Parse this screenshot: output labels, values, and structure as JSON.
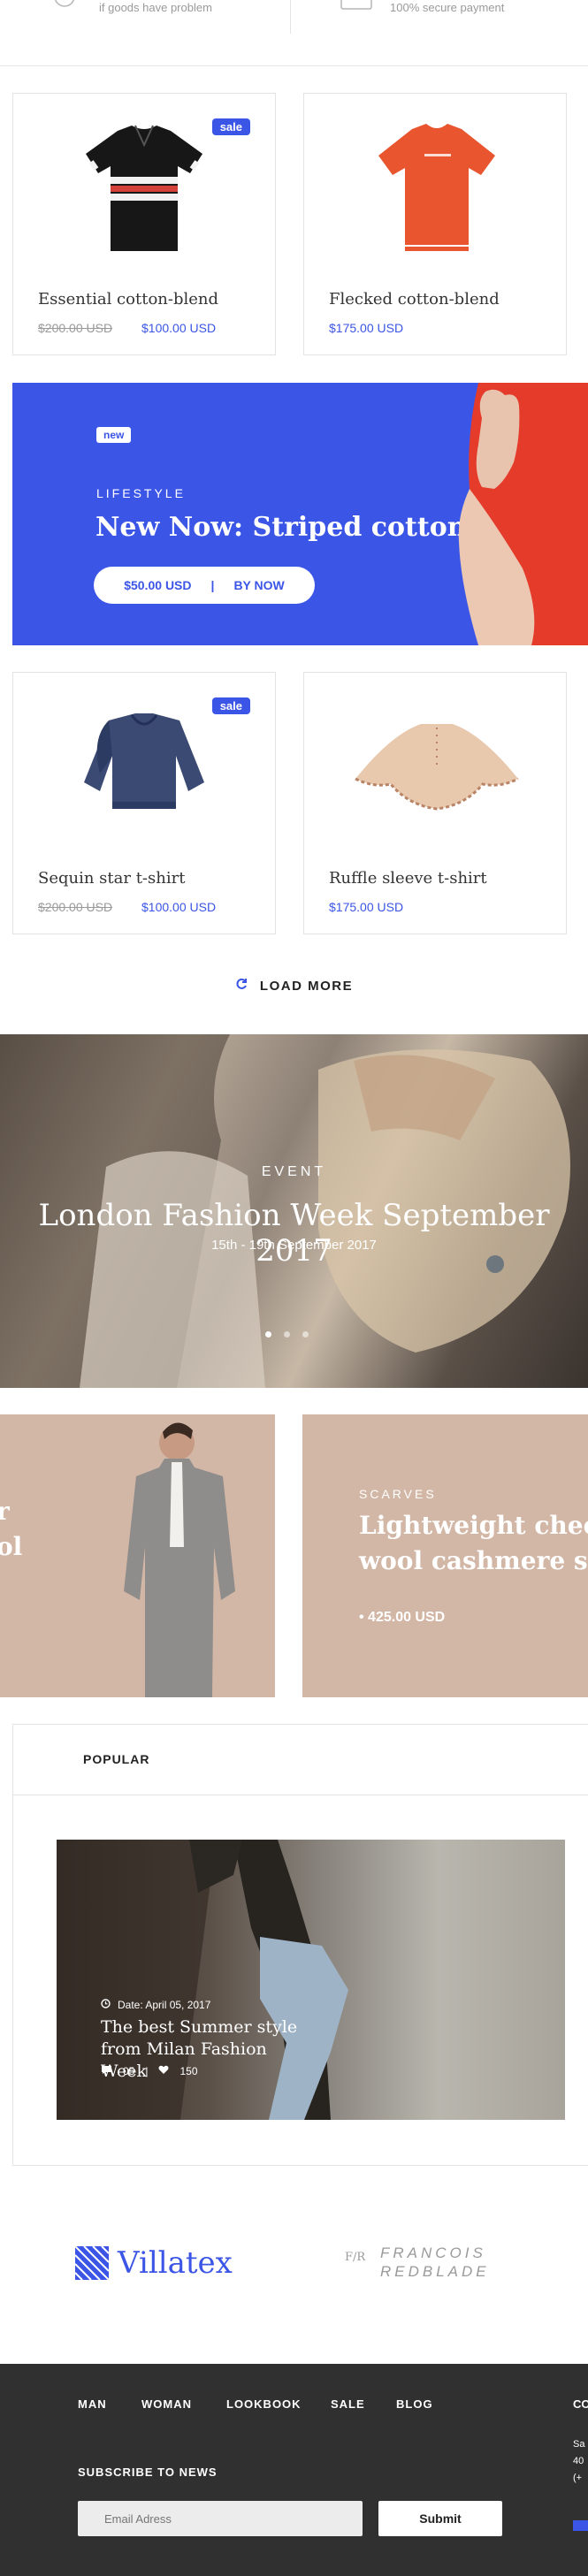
{
  "features": {
    "left_text": "if goods have problem",
    "right_text": "100% secure payment"
  },
  "products_row1": [
    {
      "name": "Essential cotton-blend",
      "old_price": "$200.00 USD",
      "price": "$100.00 USD",
      "badge": "sale"
    },
    {
      "name": "Flecked cotton-blend",
      "old_price": "",
      "price": "$175.00 USD",
      "badge": ""
    }
  ],
  "promo": {
    "badge": "new",
    "kicker": "LIFESTYLE",
    "title": "New Now: Striped cotton",
    "price": "$50.00 USD",
    "separator": "|",
    "cta": "BY NOW"
  },
  "products_row2": [
    {
      "name": "Sequin star t-shirt",
      "old_price": "$200.00 USD",
      "price": "$100.00 USD",
      "badge": "sale"
    },
    {
      "name": "Ruffle sleeve t-shirt",
      "old_price": "",
      "price": "$175.00 USD",
      "badge": ""
    }
  ],
  "load_more": "LOAD MORE",
  "event": {
    "kicker": "EVENT",
    "title": "London Fashion Week September 2017",
    "dates": "15th - 19th September 2017"
  },
  "tiles": {
    "left_partial_line1": "r",
    "left_partial_line2": "ol",
    "right_kicker": "SCARVES",
    "right_title_line1": "Lightweight check",
    "right_title_line2": "wool cashmere sca",
    "right_price": "• 425.00 USD"
  },
  "popular": {
    "heading": "POPULAR",
    "post": {
      "date": "Date: April 05, 2017",
      "title": "The best Summer style from Milan Fashion Week",
      "comments": "05",
      "separator": "|",
      "likes": "150"
    }
  },
  "brands": {
    "brand1": "Villatex",
    "brand2_mark": "F/R",
    "brand2_line1": "FRANCOIS",
    "brand2_line2": "REDBLADE"
  },
  "footer": {
    "nav": [
      "MAN",
      "WOMAN",
      "LOOKBOOK",
      "SALE",
      "BLOG"
    ],
    "subscribe_label": "SUBSCRIBE TO NEWS",
    "email_placeholder": "Email Adress",
    "submit_label": "Submit",
    "right_col_title": "CO",
    "right_col_line1": "Sa",
    "right_col_line2": "40",
    "right_col_line3": "(+"
  },
  "colors": {
    "accent": "#3b55e6",
    "tile_bg": "#d3b7a6",
    "footer_bg": "#303030"
  }
}
